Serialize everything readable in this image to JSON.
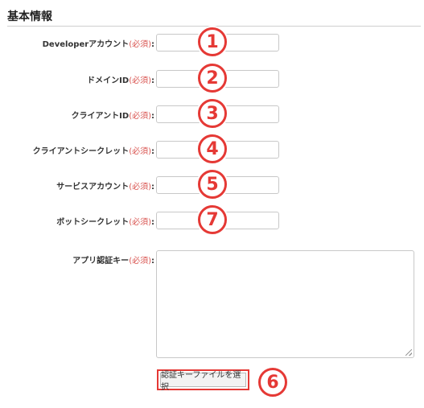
{
  "section": {
    "title": "基本情報"
  },
  "form": {
    "required_mark": "(必須)",
    "colon": ":",
    "fields": [
      {
        "label": "Developerアカウント",
        "badge": "1"
      },
      {
        "label": "ドメインID",
        "badge": "2"
      },
      {
        "label": "クライアントID",
        "badge": "3"
      },
      {
        "label": "クライアントシークレット",
        "badge": "4"
      },
      {
        "label": "サービスアカウント",
        "badge": "5"
      },
      {
        "label": "ボットシークレット",
        "badge": "7"
      }
    ],
    "app_key": {
      "label": "アプリ認証キー"
    },
    "file_button": {
      "label": "認証キーファイルを選択",
      "badge": "6"
    }
  },
  "colors": {
    "accent": "#e53935",
    "required": "#d9534f"
  }
}
